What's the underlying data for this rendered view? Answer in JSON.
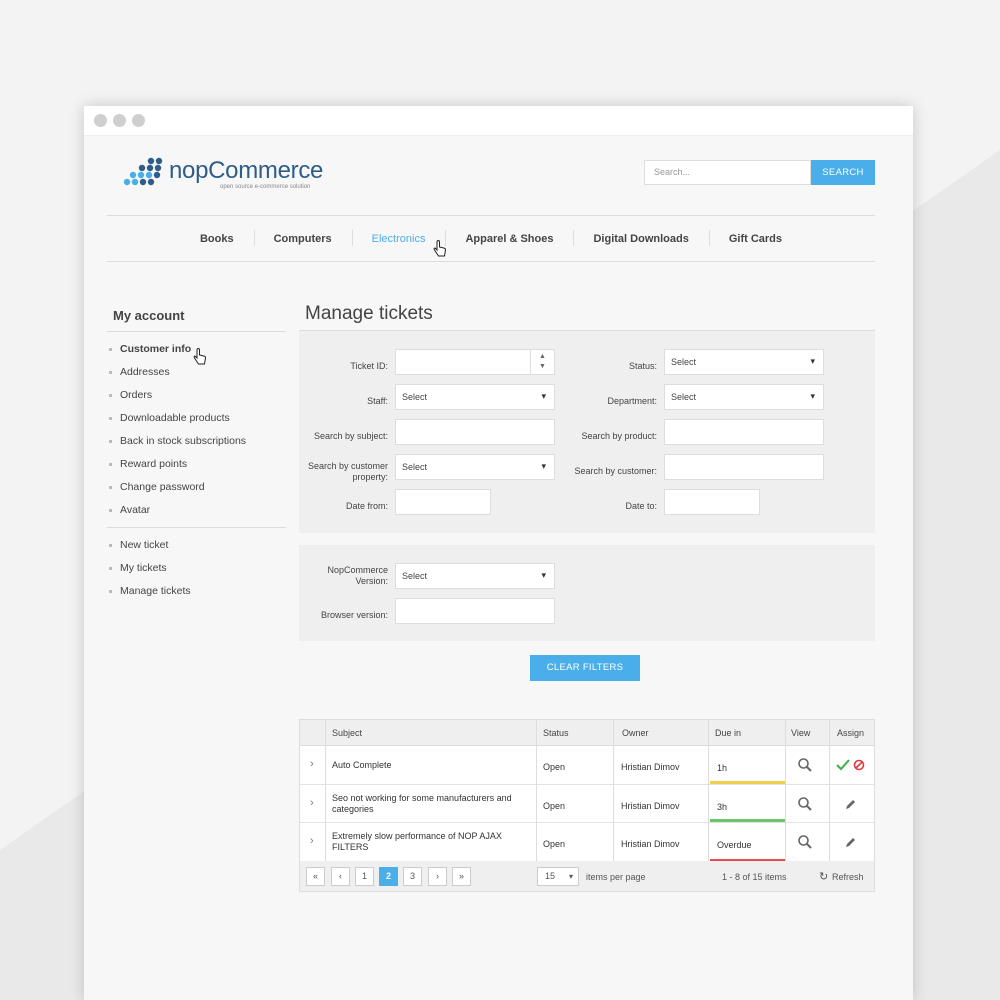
{
  "header": {
    "logo_name": "nopCommerce",
    "logo_tagline": "open source e-commerce solution",
    "search_placeholder": "Search...",
    "search_button": "SEARCH"
  },
  "nav": [
    {
      "label": "Books",
      "active": false
    },
    {
      "label": "Computers",
      "active": false
    },
    {
      "label": "Electronics",
      "active": true
    },
    {
      "label": "Apparel & Shoes",
      "active": false
    },
    {
      "label": "Digital Downloads",
      "active": false
    },
    {
      "label": "Gift Cards",
      "active": false
    }
  ],
  "sidebar": {
    "title": "My account",
    "account_items": [
      "Customer info",
      "Addresses",
      "Orders",
      "Downloadable products",
      "Back in stock subscriptions",
      "Reward points",
      "Change password",
      "Avatar"
    ],
    "ticket_items": [
      "New ticket",
      "My tickets",
      "Manage tickets"
    ]
  },
  "main": {
    "title": "Manage tickets",
    "filters": {
      "ticket_id": "Ticket ID:",
      "status": "Status:",
      "status_value": "Select",
      "staff": "Staff:",
      "staff_value": "Select",
      "department": "Department:",
      "department_value": "Select",
      "search_subject": "Search by subject:",
      "search_product": "Search by product:",
      "search_customer_property": "Search by customer property:",
      "search_customer_property_value": "Select",
      "search_customer": "Search by customer:",
      "date_from": "Date from:",
      "date_to": "Date to:"
    },
    "filters2": {
      "nop_version": "NopCommerce Version:",
      "nop_version_value": "Select",
      "browser_version": "Browser version:"
    },
    "clear_button": "CLEAR FILTERS"
  },
  "table": {
    "headers": [
      "Subject",
      "Status",
      "Owner",
      "Due in",
      "View",
      "Assign"
    ],
    "rows": [
      {
        "subject": "Auto Complete",
        "status": "Open",
        "owner": "Hristian Dimov",
        "due": "1h",
        "due_color": "#f0d04a"
      },
      {
        "subject": "Seo not working for some manufacturers and categories",
        "status": "Open",
        "owner": "Hristian Dimov",
        "due": "3h",
        "due_color": "#6cc46c"
      },
      {
        "subject": "Extremely slow performance of NOP AJAX FILTERS",
        "status": "Open",
        "owner": "Hristian Dimov",
        "due": "Overdue",
        "due_color": "#e8494d"
      }
    ]
  },
  "pager": {
    "pages": [
      "1",
      "2",
      "3"
    ],
    "current_page": "2",
    "page_size": "15",
    "items_per_page": "items per page",
    "range": "1 - 8 of 15 items",
    "refresh": "Refresh"
  },
  "colors": {
    "accent": "#4aaeea"
  }
}
